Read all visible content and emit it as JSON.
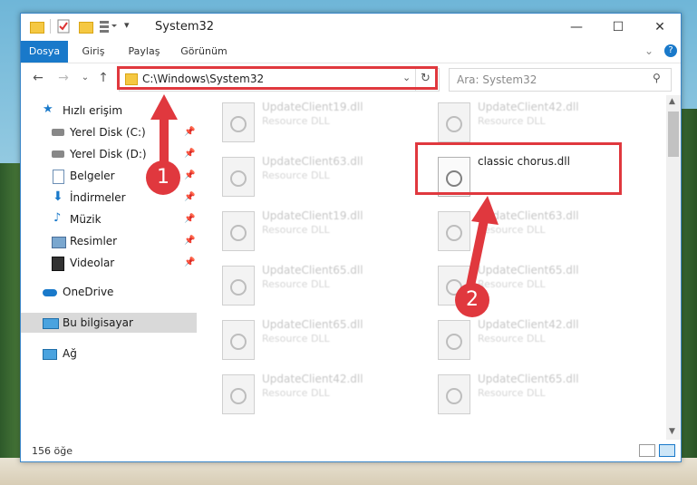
{
  "window": {
    "title": "System32",
    "controls": {
      "minimize": "—",
      "maximize": "☐",
      "close": "✕"
    }
  },
  "ribbon": {
    "tabs": [
      {
        "label": "Dosya",
        "active": true
      },
      {
        "label": "Giriş"
      },
      {
        "label": "Paylaş"
      },
      {
        "label": "Görünüm"
      }
    ]
  },
  "address": {
    "path": "C:\\Windows\\System32",
    "search_placeholder": "Ara: System32"
  },
  "sidebar": {
    "items": [
      {
        "label": "Hızlı erişim",
        "icon": "star-icon"
      },
      {
        "label": "Yerel Disk (C:)",
        "icon": "drive-icon",
        "pinned": true
      },
      {
        "label": "Yerel Disk (D:)",
        "icon": "drive-icon",
        "pinned": true
      },
      {
        "label": "Belgeler",
        "icon": "documents-icon",
        "pinned": true
      },
      {
        "label": "İndirmeler",
        "icon": "download-icon",
        "pinned": true
      },
      {
        "label": "Müzik",
        "icon": "music-icon",
        "pinned": true
      },
      {
        "label": "Resimler",
        "icon": "pictures-icon",
        "pinned": true
      },
      {
        "label": "Videolar",
        "icon": "video-icon",
        "pinned": true
      },
      {
        "label": "OneDrive",
        "icon": "cloud-icon"
      },
      {
        "label": "Bu bilgisayar",
        "icon": "computer-icon",
        "selected": true
      },
      {
        "label": "Ağ",
        "icon": "network-icon"
      }
    ]
  },
  "files": [
    {
      "name": "UpdateClient19.dll",
      "desc": "Resource DLL"
    },
    {
      "name": "UpdateClient42.dll",
      "desc": "Resource DLL"
    },
    {
      "name": "UpdateClient63.dll",
      "desc": "Resource DLL"
    },
    {
      "name": "classic chorus.dll",
      "desc": "",
      "highlighted": true
    },
    {
      "name": "UpdateClient19.dll",
      "desc": "Resource DLL"
    },
    {
      "name": "UpdateClient63.dll",
      "desc": "Resource DLL"
    },
    {
      "name": "UpdateClient65.dll",
      "desc": "Resource DLL"
    },
    {
      "name": "UpdateClient65.dll",
      "desc": "Resource DLL"
    },
    {
      "name": "UpdateClient65.dll",
      "desc": "Resource DLL"
    },
    {
      "name": "UpdateClient42.dll",
      "desc": "Resource DLL"
    },
    {
      "name": "UpdateClient42.dll",
      "desc": "Resource DLL"
    },
    {
      "name": "UpdateClient65.dll",
      "desc": "Resource DLL"
    }
  ],
  "status": {
    "count": "156 öğe"
  },
  "annotations": {
    "step1": "1",
    "step2": "2"
  },
  "colors": {
    "accent": "#1979ca",
    "highlight": "#e0383e"
  }
}
